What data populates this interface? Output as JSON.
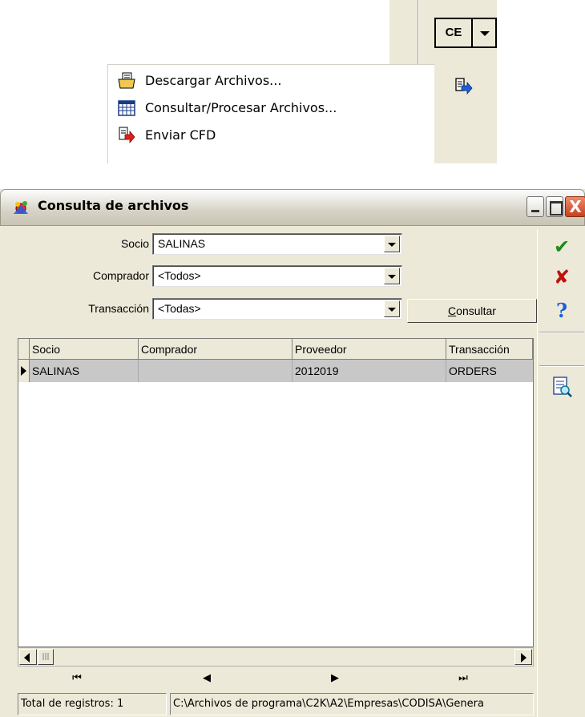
{
  "toolbar": {
    "ce_label": "CE"
  },
  "menu": {
    "items": [
      {
        "label": "Descargar Archivos...",
        "icon": "download-folder-icon"
      },
      {
        "label": "Consultar/Procesar Archivos...",
        "icon": "spreadsheet-icon"
      },
      {
        "label": "Enviar CFD",
        "icon": "send-document-icon"
      }
    ]
  },
  "window": {
    "title": "Consulta de archivos",
    "close_glyph": "X"
  },
  "filters": {
    "socio_label": "Socio",
    "socio_value": "SALINAS",
    "comprador_label": "Comprador",
    "comprador_value": "<Todos>",
    "transaccion_label": "Transacción",
    "transaccion_value": "<Todas>",
    "consultar_label": "onsultar",
    "consultar_accel": "C"
  },
  "side": {
    "ok_glyph": "✔",
    "cancel_glyph": "✘",
    "help_glyph": "?"
  },
  "grid": {
    "columns": [
      "Socio",
      "Comprador",
      "Proveedor",
      "Transacción"
    ],
    "rows": [
      {
        "socio": "SALINAS",
        "comprador": "",
        "proveedor": "2012019",
        "transaccion": "ORDERS"
      }
    ]
  },
  "scroll": {
    "thumb_glyph": "|||"
  },
  "nav": {
    "first": "⏮",
    "prev": "◀",
    "next": "▶",
    "last": "⏭"
  },
  "status": {
    "total": "Total de registros: 1",
    "path": "C:\\Archivos de programa\\C2K\\A2\\Empresas\\CODISA\\Genera"
  },
  "colors": {
    "window_bg": "#ece9d8",
    "selected_row": "#c8c8c8",
    "close_button": "#c6411e"
  }
}
